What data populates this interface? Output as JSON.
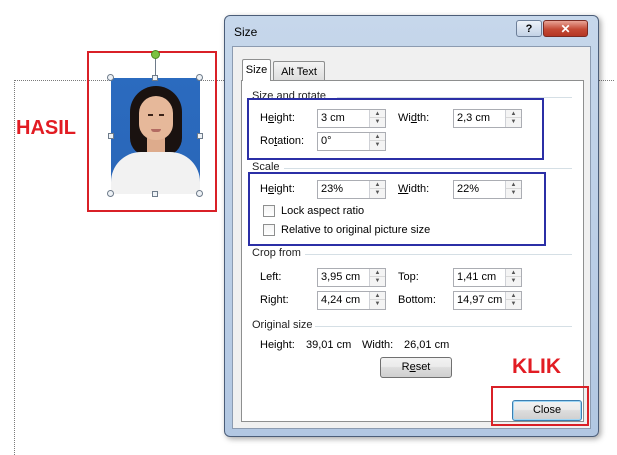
{
  "annotations": {
    "hasil": "HASIL",
    "klik": "KLIK"
  },
  "dialog": {
    "title": "Size",
    "help_button": "?",
    "close_button": "✕",
    "tabs": [
      {
        "label": "Size",
        "active": true
      },
      {
        "label": "Alt Text",
        "active": false
      }
    ],
    "size_and_rotate": {
      "label": "Size and rotate",
      "height_label": "Height:",
      "height_value": "3 cm",
      "width_label": "Width:",
      "width_value": "2,3 cm",
      "rotation_label": "Rotation:",
      "rotation_value": "0°"
    },
    "scale": {
      "label": "Scale",
      "height_label": "Height:",
      "height_value": "23%",
      "width_label": "Width:",
      "width_value": "22%",
      "lock_aspect_ratio": "Lock aspect ratio",
      "lock_aspect_ratio_checked": false,
      "relative_to_original": "Relative to original picture size",
      "relative_to_original_checked": false
    },
    "crop_from": {
      "label": "Crop from",
      "left_label": "Left:",
      "left_value": "3,95 cm",
      "top_label": "Top:",
      "top_value": "1,41 cm",
      "right_label": "Right:",
      "right_value": "4,24 cm",
      "bottom_label": "Bottom:",
      "bottom_value": "14,97 cm"
    },
    "original_size": {
      "label": "Original size",
      "height_label": "Height:",
      "height_value": "39,01 cm",
      "width_label": "Width:",
      "width_value": "26,01 cm"
    },
    "reset_button": "Reset",
    "close_button_bottom": "Close"
  },
  "colors": {
    "annotation_red": "#e21c23",
    "highlight_blue": "#2b2fa6",
    "window_frame": "#b2c7e2"
  }
}
